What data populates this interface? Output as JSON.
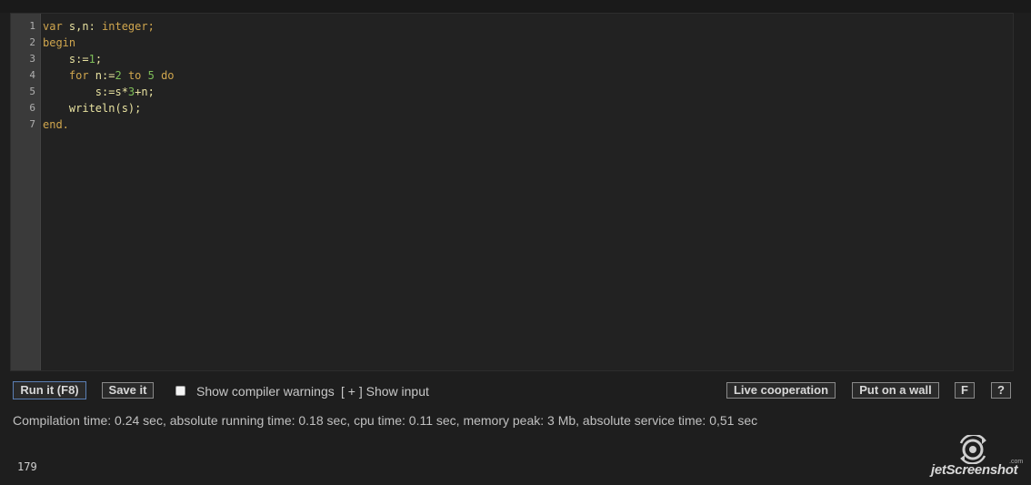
{
  "editor": {
    "line_numbers": [
      "1",
      "2",
      "3",
      "4",
      "5",
      "6",
      "7"
    ],
    "lines": [
      [
        {
          "t": "var ",
          "c": "kw"
        },
        {
          "t": "s,n: ",
          "c": "id"
        },
        {
          "t": "integer;",
          "c": "kw"
        }
      ],
      [
        {
          "t": "begin",
          "c": "kw"
        }
      ],
      [
        {
          "t": "    s:=",
          "c": "id"
        },
        {
          "t": "1",
          "c": "num"
        },
        {
          "t": ";",
          "c": "id"
        }
      ],
      [
        {
          "t": "    for ",
          "c": "kw"
        },
        {
          "t": "n:=",
          "c": "id"
        },
        {
          "t": "2",
          "c": "num"
        },
        {
          "t": " to ",
          "c": "kw"
        },
        {
          "t": "5",
          "c": "num"
        },
        {
          "t": " do",
          "c": "kw"
        }
      ],
      [
        {
          "t": "        s:=s*",
          "c": "id"
        },
        {
          "t": "3",
          "c": "num"
        },
        {
          "t": "+n;",
          "c": "id"
        }
      ],
      [
        {
          "t": "    writeln(s);",
          "c": "id"
        }
      ],
      [
        {
          "t": "end.",
          "c": "kw"
        }
      ]
    ]
  },
  "toolbar": {
    "run_label": "Run it (F8)",
    "save_label": "Save it",
    "warnings_label": "Show compiler warnings",
    "show_input_label": "[ + ] Show input",
    "live_label": "Live cooperation",
    "wall_label": "Put on a wall",
    "f_label": "F",
    "help_label": "?"
  },
  "status": {
    "text": "Compilation time: 0.24 sec, absolute running time: 0.18 sec, cpu time: 0.11 sec, memory peak: 3 Mb, absolute service time: 0,51 sec"
  },
  "output": {
    "text": "179"
  },
  "watermark": {
    "main": "jetScreenshot",
    "suffix": ".com"
  },
  "colors": {
    "keyword": "#d0a64e",
    "number": "#7fbf59",
    "identifier": "#e8e2a0",
    "background": "#1e1e1e"
  }
}
